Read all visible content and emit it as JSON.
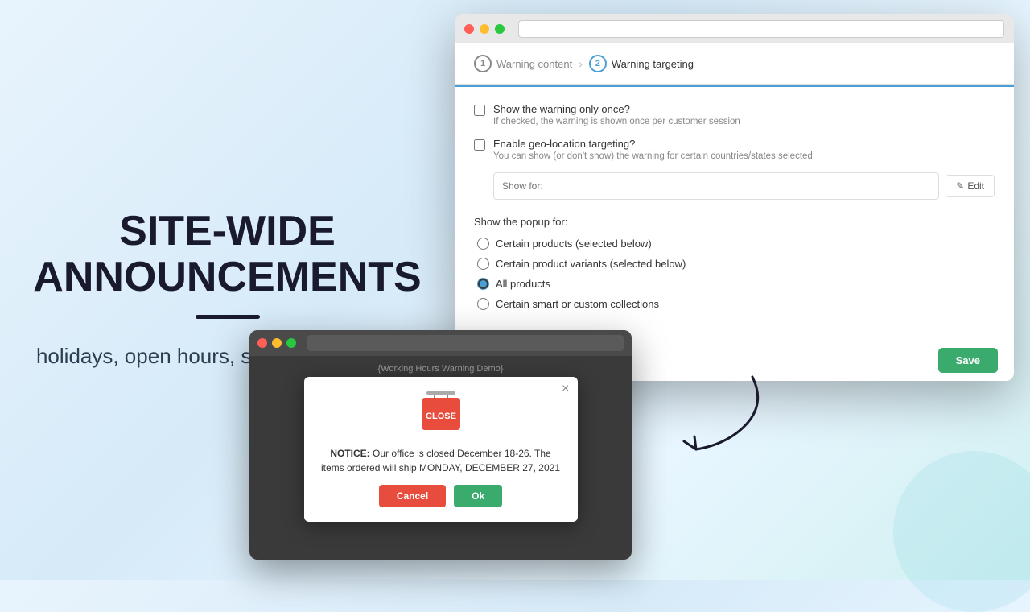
{
  "left": {
    "title_line1": "SITE-WIDE",
    "title_line2": "ANNOUNCEMENTS",
    "subtitle": "holidays, open hours, shipping delay, etc."
  },
  "browser": {
    "steps": [
      {
        "number": "1",
        "label": "Warning content",
        "active": false
      },
      {
        "number": "2",
        "label": "Warning targeting",
        "active": true
      }
    ],
    "checkbox_once": {
      "label": "Show the warning only once?",
      "hint": "If checked, the warning is shown once per customer session"
    },
    "checkbox_geo": {
      "label": "Enable geo-location targeting?",
      "hint": "You can show (or don't show) the warning for certain countries/states selected"
    },
    "show_for_placeholder": "Show for:",
    "edit_label": "Edit",
    "popup_section_label": "Show the popup for:",
    "radio_options": [
      {
        "id": "opt1",
        "label": "Certain products (selected below)",
        "checked": false
      },
      {
        "id": "opt2",
        "label": "Certain product variants (selected below)",
        "checked": false
      },
      {
        "id": "opt3",
        "label": "All products",
        "checked": true
      },
      {
        "id": "opt4",
        "label": "Certain smart or custom collections",
        "checked": false
      }
    ],
    "save_label": "Save"
  },
  "demo_browser": {
    "title": "{Working Hours Warning Demo}"
  },
  "popup": {
    "close_char": "×",
    "notice_prefix": "NOTICE:",
    "notice_text": " Our office is closed December 18-26. The items ordered will ship MONDAY, DECEMBER 27, 2021",
    "sign_text": "CLOSE",
    "cancel_label": "Cancel",
    "ok_label": "Ok"
  },
  "icons": {
    "pencil": "✎",
    "close": "×"
  }
}
